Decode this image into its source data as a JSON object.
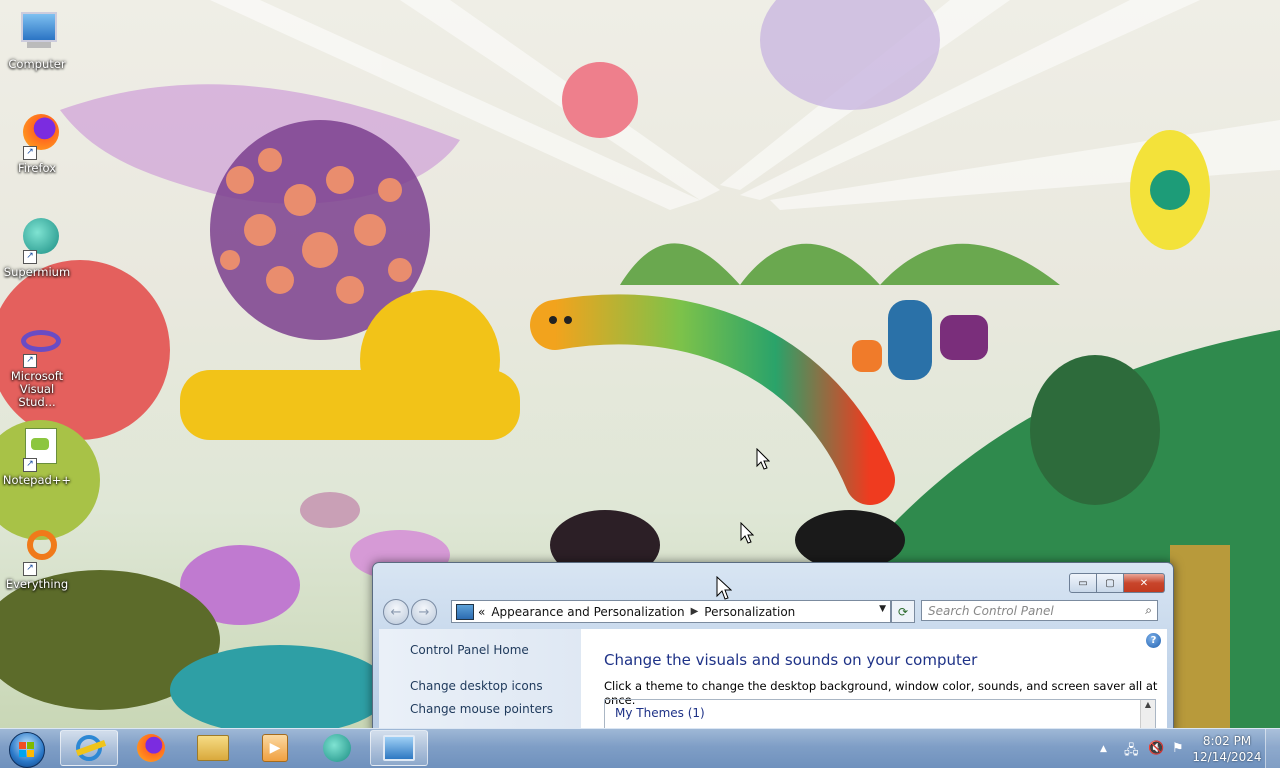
{
  "desktop": {
    "icons": [
      {
        "label": "Computer",
        "icon": "computer-icon"
      },
      {
        "label": "Firefox",
        "icon": "firefox-icon"
      },
      {
        "label": "Supermium",
        "icon": "supermium-icon"
      },
      {
        "label": "Microsoft Visual Stud...",
        "icon": "visual-studio-icon"
      },
      {
        "label": "Notepad++",
        "icon": "notepadpp-icon"
      },
      {
        "label": "Everything",
        "icon": "everything-icon"
      }
    ]
  },
  "window": {
    "controls": {
      "minimize": "▭",
      "maximize": "▢",
      "close": "✕"
    },
    "breadcrumb": {
      "prefix": "«",
      "parent": "Appearance and Personalization",
      "current": "Personalization"
    },
    "search_placeholder": "Search Control Panel",
    "sidebar": {
      "home": "Control Panel Home",
      "links": [
        "Change desktop icons",
        "Change mouse pointers"
      ]
    },
    "main": {
      "heading": "Change the visuals and sounds on your computer",
      "description": "Click a theme to change the desktop background, window color, sounds, and screen saver all at once.",
      "themes_group": "My Themes (1)"
    },
    "help_symbol": "?"
  },
  "taskbar": {
    "pinned": [
      {
        "icon": "internet-explorer-icon",
        "active": true
      },
      {
        "icon": "firefox-icon",
        "active": false
      },
      {
        "icon": "file-explorer-icon",
        "active": false
      },
      {
        "icon": "media-player-icon",
        "active": false
      },
      {
        "icon": "supermium-icon",
        "active": false
      },
      {
        "icon": "control-panel-icon",
        "active": true
      }
    ],
    "tray": {
      "time": "8:02 PM",
      "date": "12/14/2024"
    }
  },
  "colors": {
    "taskbar": "#7f9ec6",
    "heading": "#1e3287",
    "close": "#c8452b"
  }
}
